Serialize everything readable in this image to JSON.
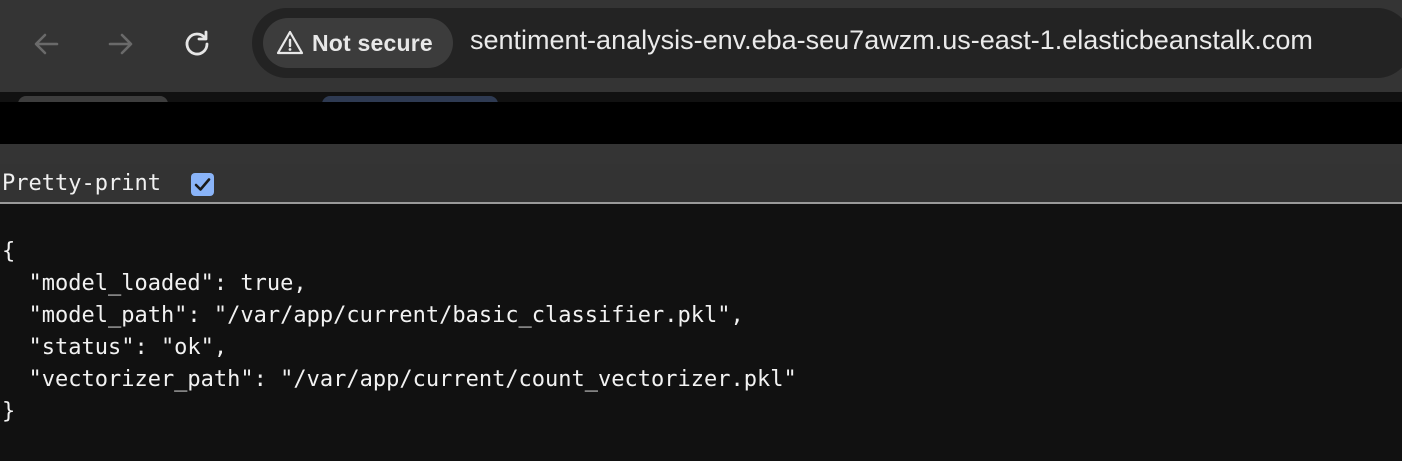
{
  "browser": {
    "security_label": "Not secure",
    "url": "sentiment-analysis-env.eba-seu7awzm.us-east-1.elasticbeanstalk.com"
  },
  "viewer": {
    "pretty_print_label": "Pretty-print",
    "pretty_print_checked": true
  },
  "json_lines": [
    "{",
    "  \"model_loaded\": true,",
    "  \"model_path\": \"/var/app/current/basic_classifier.pkl\",",
    "  \"status\": \"ok\",",
    "  \"vectorizer_path\": \"/var/app/current/count_vectorizer.pkl\"",
    "}"
  ],
  "colors": {
    "toolbar_bg": "#343434",
    "omnibox_bg": "#232323",
    "chip_bg": "#3c3c3c",
    "page_bg": "#111111",
    "checkbox_accent": "#8ab4f8"
  }
}
